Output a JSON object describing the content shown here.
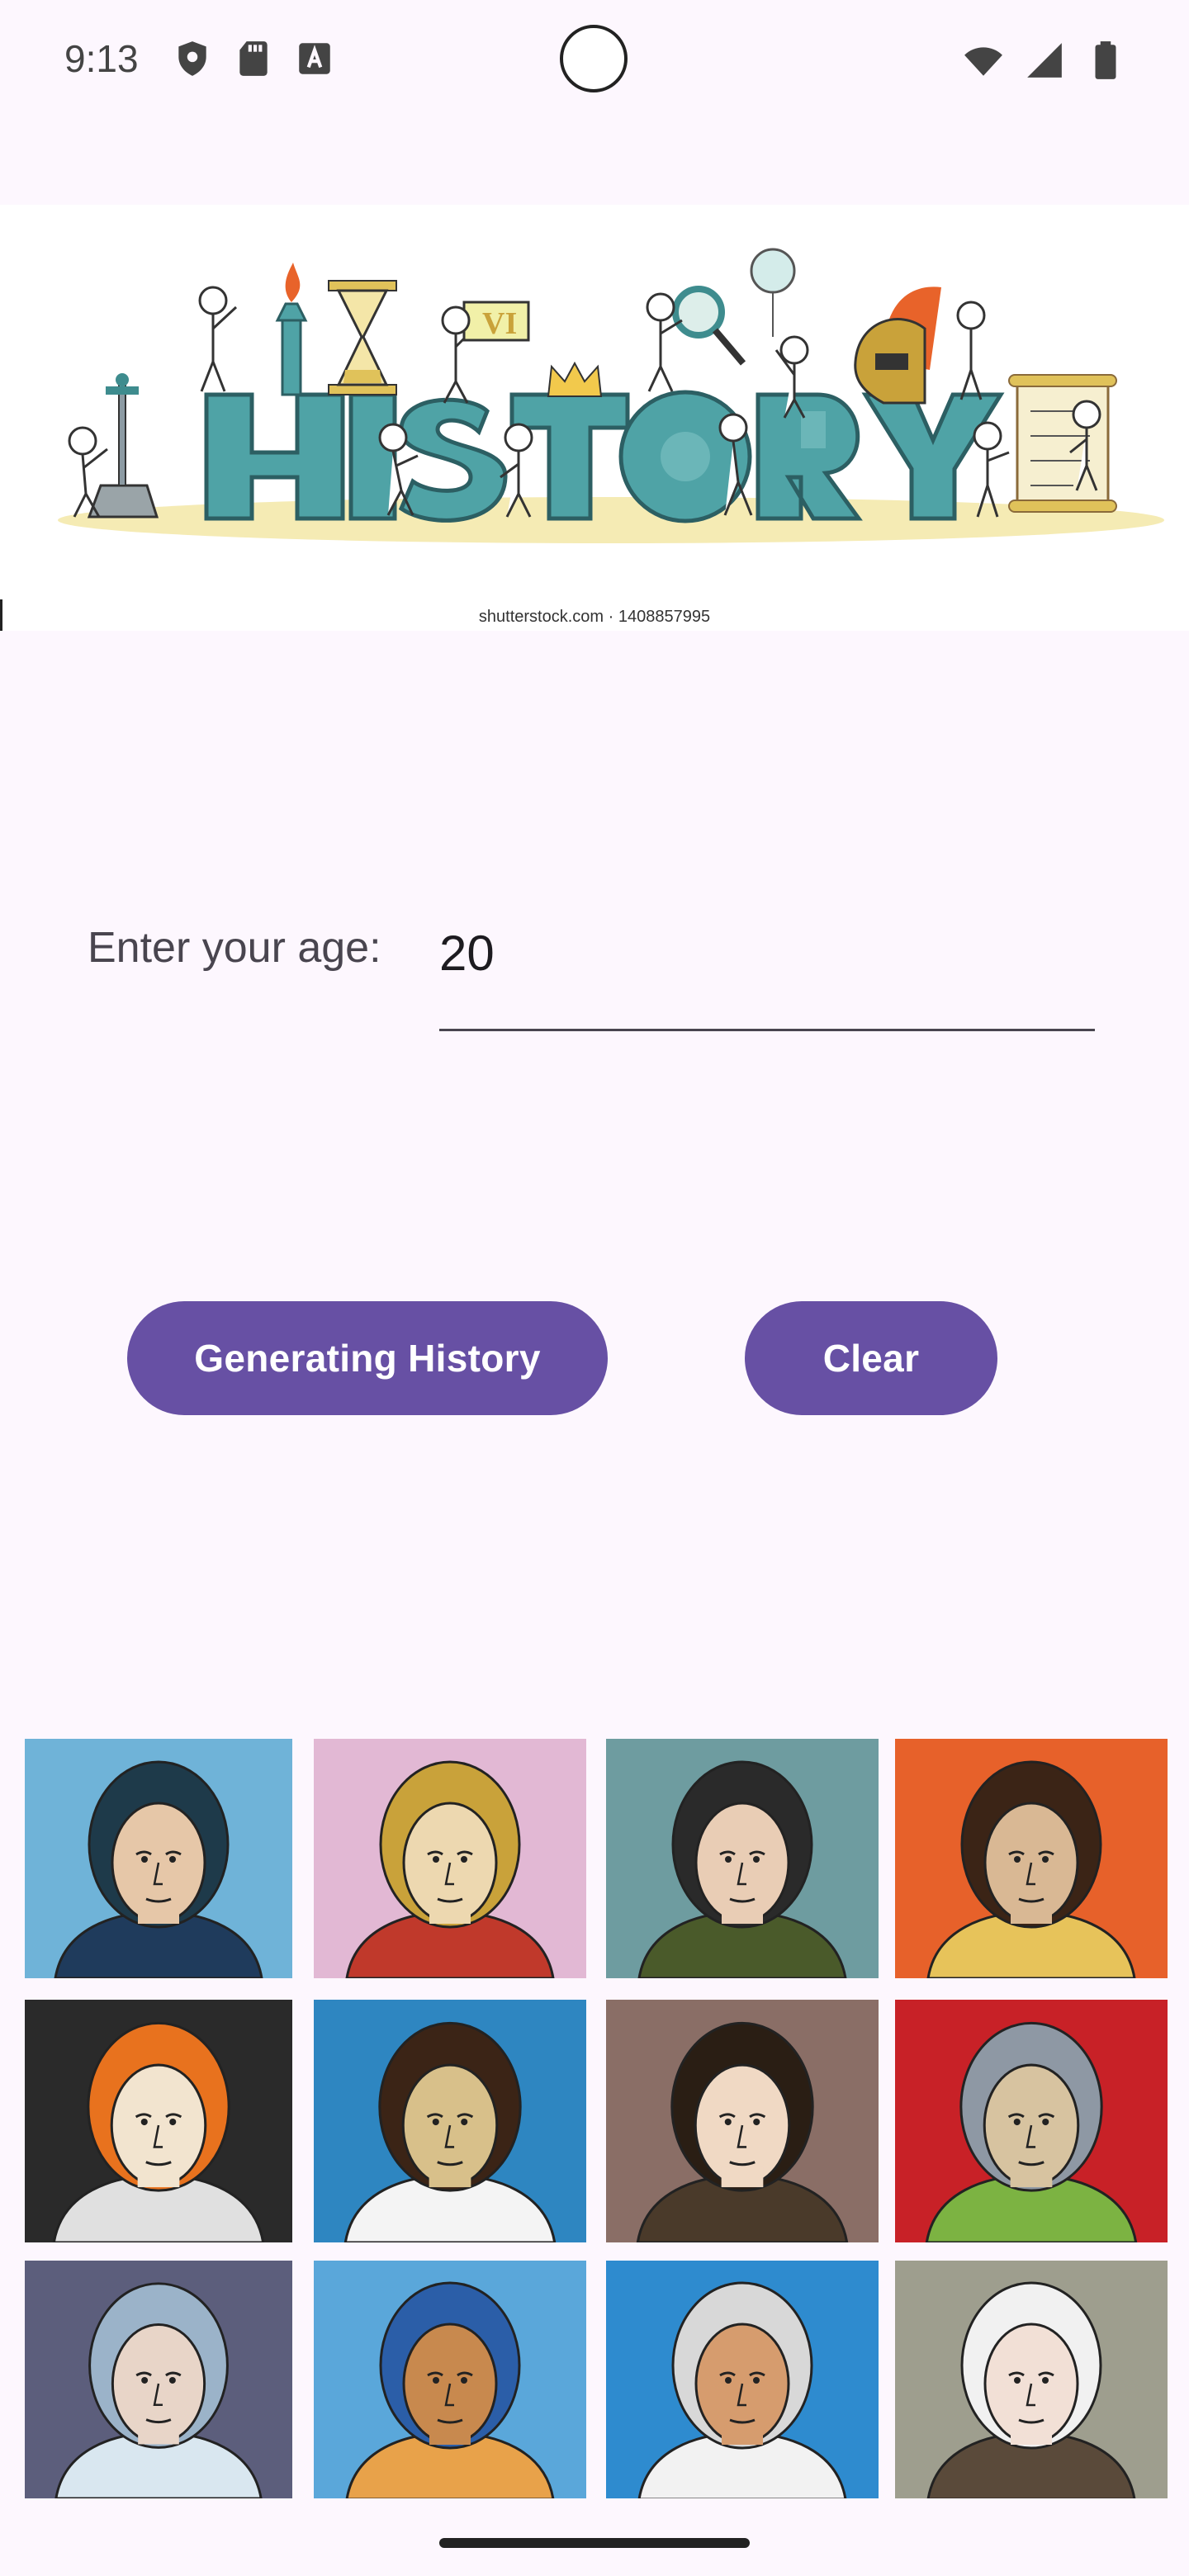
{
  "status_bar": {
    "time": "9:13",
    "left_icons": [
      "shield-icon",
      "sd-card-icon",
      "keyboard-a-icon"
    ],
    "right_icons": [
      "wifi-icon",
      "cell-signal-icon",
      "battery-icon"
    ]
  },
  "banner": {
    "title": "HISTORY",
    "credit": "shutterstock.com · 1408857995"
  },
  "age_form": {
    "label": "Enter your age:",
    "value": "20"
  },
  "buttons": {
    "generate_label": "Generating History",
    "clear_label": "Clear"
  },
  "portraits": [
    {
      "name": "portrait-man-black-hat",
      "bg": "#6FB3D8"
    },
    {
      "name": "portrait-queen-crown",
      "bg": "#E2B8D4"
    },
    {
      "name": "portrait-man-dark-cap",
      "bg": "#6E9CA0"
    },
    {
      "name": "portrait-man-jeweled-cap",
      "bg": "#E7612A"
    },
    {
      "name": "portrait-queen-ruff-collar",
      "bg": "#2A2A2A"
    },
    {
      "name": "portrait-bald-man-ruff",
      "bg": "#2E86C1"
    },
    {
      "name": "portrait-woman-hood",
      "bg": "#8A6E66"
    },
    {
      "name": "portrait-knight-chainmail",
      "bg": "#C82127"
    },
    {
      "name": "portrait-woman-bonnet",
      "bg": "#5C5E7C"
    },
    {
      "name": "portrait-pharaoh",
      "bg": "#5AA7DA"
    },
    {
      "name": "portrait-man-round-glasses",
      "bg": "#2E8BCF"
    },
    {
      "name": "portrait-woman-white-hair-crown",
      "bg": "#9E9E8E"
    }
  ]
}
